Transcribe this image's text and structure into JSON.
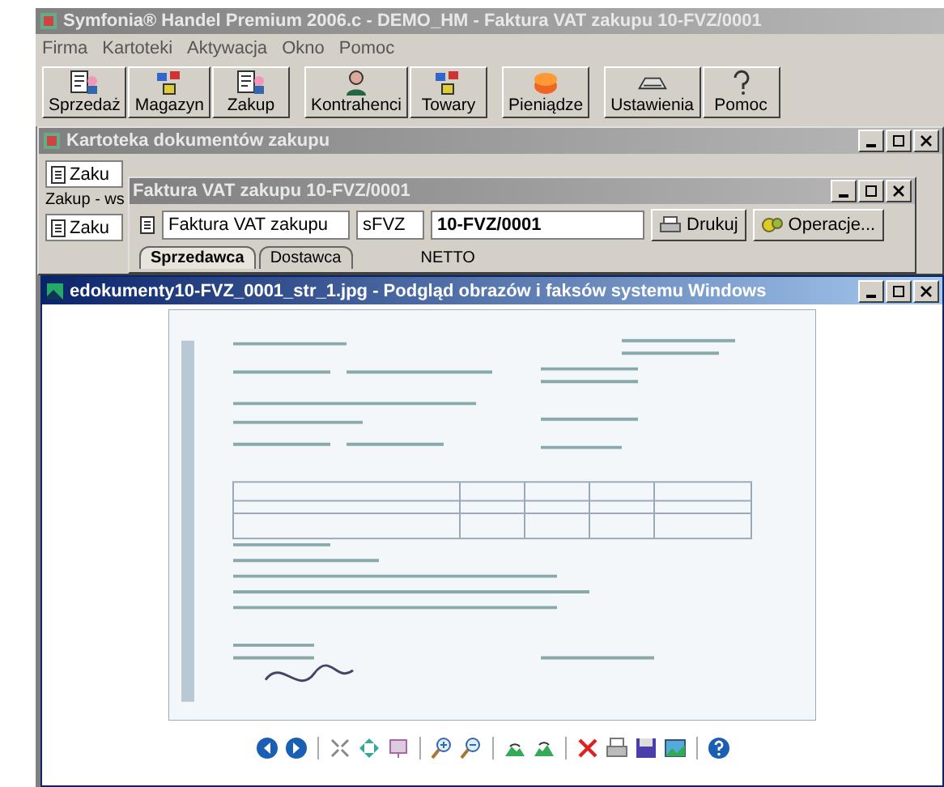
{
  "app": {
    "title": "Symfonia® Handel Premium 2006.c - DEMO_HM - Faktura VAT zakupu 10-FVZ/0001",
    "menu": [
      "Firma",
      "Kartoteki",
      "Aktywacja",
      "Okno",
      "Pomoc"
    ],
    "toolbar_groups": [
      [
        {
          "label": "Sprzedaż",
          "kind": "document"
        },
        {
          "label": "Magazyn",
          "kind": "boxes"
        },
        {
          "label": "Zakup",
          "kind": "document"
        }
      ],
      [
        {
          "label": "Kontrahenci",
          "kind": "person"
        },
        {
          "label": "Towary",
          "kind": "boxes"
        }
      ],
      [
        {
          "label": "Pieniądze",
          "kind": "coins"
        }
      ],
      [
        {
          "label": "Ustawienia",
          "kind": "device"
        },
        {
          "label": "Pomoc",
          "kind": "question"
        }
      ]
    ]
  },
  "kartoteka": {
    "title": "Kartoteka dokumentów zakupu",
    "items": [
      {
        "label": "Zaku",
        "kind": "document"
      },
      {
        "label": "Zakup - ws",
        "kind": "heading"
      },
      {
        "label": "Zaku",
        "kind": "document"
      }
    ]
  },
  "faktura": {
    "title": "Faktura VAT zakupu 10-FVZ/0001",
    "type": "Faktura VAT zakupu",
    "series": "sFVZ",
    "number": "10-FVZ/0001",
    "buttons": [
      {
        "label": "Drukuj",
        "kind": "printer"
      },
      {
        "label": "Operacje...",
        "kind": "gears"
      }
    ],
    "tabs": [
      {
        "label": "Sprzedawca",
        "selected": true
      },
      {
        "label": "Dostawca",
        "selected": false
      }
    ],
    "netto": "NETTO"
  },
  "viewer": {
    "title": "edokumenty10-FVZ_0001_str_1.jpg - Podgląd obrazów i faksów systemu Windows",
    "tools": [
      {
        "kind": "previous"
      },
      {
        "kind": "next"
      },
      {
        "kind": "separator"
      },
      {
        "kind": "best-fit"
      },
      {
        "kind": "actual-size"
      },
      {
        "kind": "slideshow"
      },
      {
        "kind": "separator"
      },
      {
        "kind": "zoom-in"
      },
      {
        "kind": "zoom-out"
      },
      {
        "kind": "separator"
      },
      {
        "kind": "rotate-right"
      },
      {
        "kind": "rotate-left"
      },
      {
        "kind": "separator"
      },
      {
        "kind": "delete"
      },
      {
        "kind": "print"
      },
      {
        "kind": "save"
      },
      {
        "kind": "edit"
      },
      {
        "kind": "separator"
      },
      {
        "kind": "help"
      }
    ]
  }
}
